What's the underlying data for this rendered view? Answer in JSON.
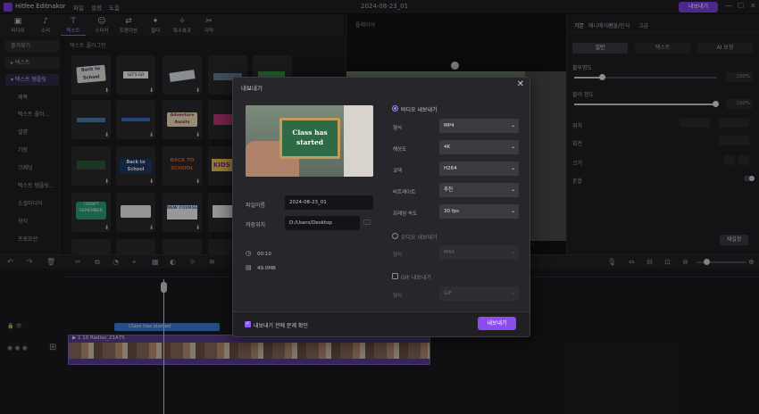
{
  "titlebar": {
    "app_name": "Hitfee Editnakor",
    "menus": [
      "파일",
      "설정",
      "도움"
    ],
    "doc_title": "2024-08-23_01",
    "export_label": "내보내기",
    "win_controls": [
      "—",
      "☐",
      "✕"
    ]
  },
  "toolbar": {
    "tools": [
      {
        "icon": "▣",
        "label": "미디어"
      },
      {
        "icon": "♪",
        "label": "소리"
      },
      {
        "icon": "T",
        "label": "텍스트"
      },
      {
        "icon": "☺",
        "label": "스티커"
      },
      {
        "icon": "⇄",
        "label": "트랜지션"
      },
      {
        "icon": "✦",
        "label": "필터"
      },
      {
        "icon": "✧",
        "label": "특수효과"
      },
      {
        "icon": "✂",
        "label": "자막"
      }
    ]
  },
  "sidebar": {
    "items": [
      "즐겨찾기",
      "▸ 텍스트",
      "▾ 텍스트 템플릿",
      "제목",
      "텍스트 플러...",
      "설명",
      "가장",
      "크레딧",
      "텍스트 템플릿...",
      "소셜미디어",
      "장식",
      "프로모션"
    ]
  },
  "mediagrid": {
    "title": "텍스트 플러그인",
    "thumb_labels": [
      "Back to School",
      "LET'S GO",
      "Adventure Awaits",
      "BACK TO SCHOOL",
      "KIDS",
      "I DON'T REMEMBER",
      "NEW COURSE"
    ]
  },
  "preview": {
    "header": "플레이어"
  },
  "rpanel": {
    "tabs": [
      "기본",
      "애니메이션",
      "버블/인식",
      "고급"
    ],
    "segments": [
      "일반",
      "텍스트",
      "AI 보정"
    ],
    "labels": [
      "불투명도",
      "블러 정도",
      "위치",
      "회전",
      "크기",
      "혼합"
    ],
    "values": [
      "100%",
      "100%"
    ],
    "reset_label": "재설정"
  },
  "timeline": {
    "text_clip": "Class has started",
    "video_clip": "▶ 1 10 Radiso_21A75"
  },
  "dialog": {
    "title": "내보내기",
    "close": "✕",
    "thumb_text": "Class has started",
    "filename_label": "파일이름",
    "filename_value": "2024-08-23_01",
    "saveto_label": "저장위치",
    "saveto_value": "D:/Users/Desktop",
    "duration": "00:10",
    "filesize": "49.0MB",
    "video_export_label": "비디오 내보내기",
    "audio_export_label": "오디오 내보내기",
    "gif_export_label": "GIF 내보내기",
    "rows": [
      {
        "label": "형식",
        "value": "MP4"
      },
      {
        "label": "해상도",
        "value": "4K"
      },
      {
        "label": "코덱",
        "value": "H264"
      },
      {
        "label": "비트레이트",
        "value": "추천"
      },
      {
        "label": "프레임 속도",
        "value": "30 fps"
      }
    ],
    "audio_row": {
      "label": "형식",
      "value": "M4A"
    },
    "gif_row": {
      "label": "형식",
      "value": "GIF"
    },
    "footer_check": "내보내기 전에 문제 확인",
    "export_button": "내보내기"
  }
}
